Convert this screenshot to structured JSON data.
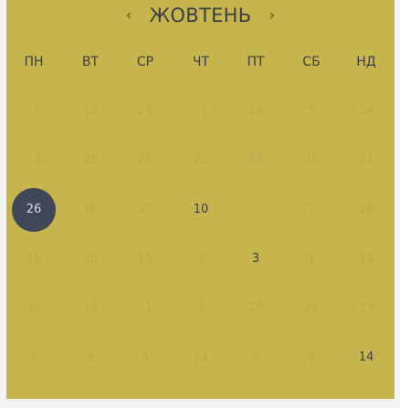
{
  "calendar": {
    "prev_icon": "chevron-left-icon",
    "next_icon": "chevron-right-icon",
    "prev_symbol": "‹",
    "next_symbol": "›",
    "month_title": "ЖОВТЕНЬ",
    "weekdays": [
      "ПН",
      "ВТ",
      "СР",
      "ЧТ",
      "ПТ",
      "СБ",
      "НД"
    ],
    "weeks": [
      [
        "15",
        "12",
        "28",
        "31",
        "14",
        "5",
        "14"
      ],
      [
        "13",
        "25",
        "26",
        "23",
        "28",
        "26",
        "21"
      ],
      [
        "26",
        "18",
        "27",
        "10",
        "3",
        "7",
        "26"
      ],
      [
        "16",
        "29",
        "15",
        "5",
        "3",
        "1",
        "14"
      ],
      [
        "30",
        "15",
        "11",
        "5",
        "25",
        "29",
        "23"
      ],
      [
        "7",
        "4",
        "4",
        "14",
        "9",
        "4",
        "14"
      ]
    ],
    "selected": {
      "week": 2,
      "day": 0
    },
    "active": [
      {
        "week": 2,
        "day": 3
      },
      {
        "week": 3,
        "day": 4
      },
      {
        "week": 5,
        "day": 6
      }
    ],
    "colors": {
      "background": "#c6b44c",
      "selected": "#404857",
      "text": "#3b3e48",
      "faded": "#bfa84a"
    }
  }
}
